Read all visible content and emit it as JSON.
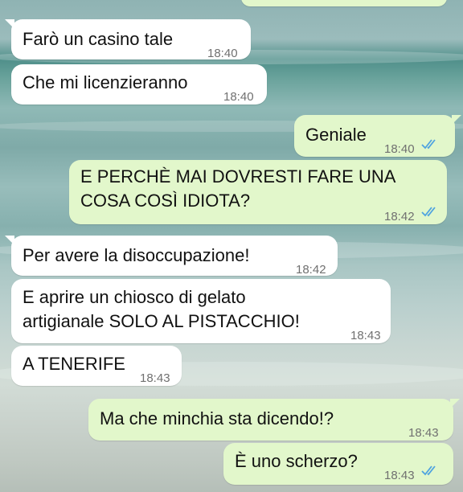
{
  "colors": {
    "incoming_bubble": "#ffffff",
    "outgoing_bubble": "#e2f7cb",
    "read_ticks": "#4fa3e0"
  },
  "messages": [
    {
      "direction": "incoming",
      "text": "Farò un casino tale",
      "time": "18:40"
    },
    {
      "direction": "incoming",
      "text": "Che mi licenzieranno",
      "time": "18:40"
    },
    {
      "direction": "outgoing",
      "text": "Geniale",
      "time": "18:40",
      "status_icon": "double-check-read-icon"
    },
    {
      "direction": "outgoing",
      "text": "E PERCHÈ MAI DOVRESTI FARE UNA\nCOSA COSÌ IDIOTA?",
      "time": "18:42",
      "status_icon": "double-check-read-icon"
    },
    {
      "direction": "incoming",
      "text": "Per avere la disoccupazione!",
      "time": "18:42"
    },
    {
      "direction": "incoming",
      "text": "E aprire un chiosco di gelato\nartigianale SOLO AL PISTACCHIO!",
      "time": "18:43"
    },
    {
      "direction": "incoming",
      "text": "A TENERIFE",
      "time": "18:43"
    },
    {
      "direction": "outgoing",
      "text": "Ma che minchia sta dicendo!?",
      "time": "18:43"
    },
    {
      "direction": "outgoing",
      "text": "È uno scherzo?",
      "time": "18:43",
      "status_icon": "double-check-read-icon"
    }
  ]
}
